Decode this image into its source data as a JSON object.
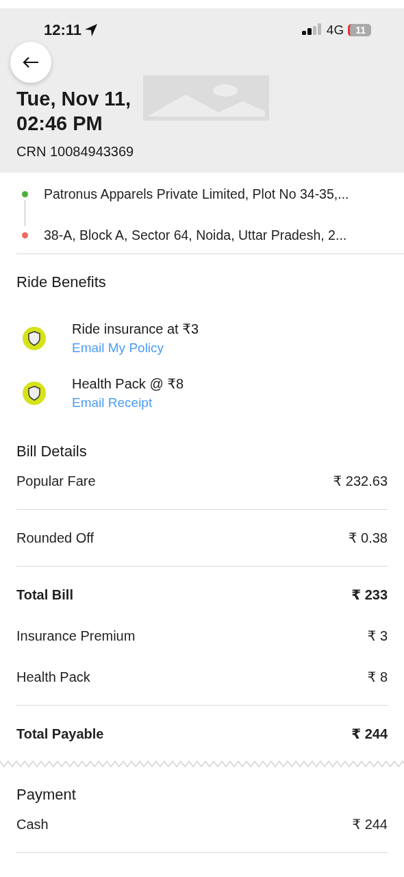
{
  "status_bar": {
    "time": "12:11",
    "network": "4G",
    "battery": "11"
  },
  "header": {
    "title_line_1": "Tue, Nov 11,",
    "title_line_2": "02:46 PM",
    "crn": "CRN 10084943369"
  },
  "route": [
    {
      "address": "Patronus Apparels Private Limited, Plot No 34-35,...",
      "color": "#4caf3a"
    },
    {
      "address": "38-A, Block A, Sector 64, Noida, Uttar Pradesh, 2...",
      "color": "#f06a5f"
    }
  ],
  "ride_benefits": {
    "title": "Ride Benefits",
    "items": [
      {
        "label": "Ride insurance at ₹3",
        "link": "Email My Policy"
      },
      {
        "label": "Health Pack @ ₹8",
        "link": "Email Receipt"
      }
    ]
  },
  "bill_details": {
    "title": "Bill Details",
    "rows": [
      {
        "kind": "normal",
        "label": "Popular Fare",
        "amount": "₹ 232.63",
        "divider_below": true
      },
      {
        "kind": "normal",
        "label": "Rounded Off",
        "amount": "₹ 0.38",
        "divider_below": true
      },
      {
        "kind": "total",
        "label": "Total Bill",
        "amount": "₹ 233",
        "divider_below": false
      },
      {
        "kind": "normal",
        "label": "Insurance Premium",
        "amount": "₹ 3",
        "divider_below": false
      },
      {
        "kind": "normal",
        "label": "Health Pack",
        "amount": "₹ 8",
        "divider_below": true
      },
      {
        "kind": "total",
        "label": "Total Payable",
        "amount": "₹ 244",
        "divider_below": false
      }
    ]
  },
  "payment": {
    "title": "Payment",
    "rows": [
      {
        "kind": "normal",
        "label": "Cash",
        "amount": "₹ 244",
        "divider_below": true
      }
    ]
  }
}
